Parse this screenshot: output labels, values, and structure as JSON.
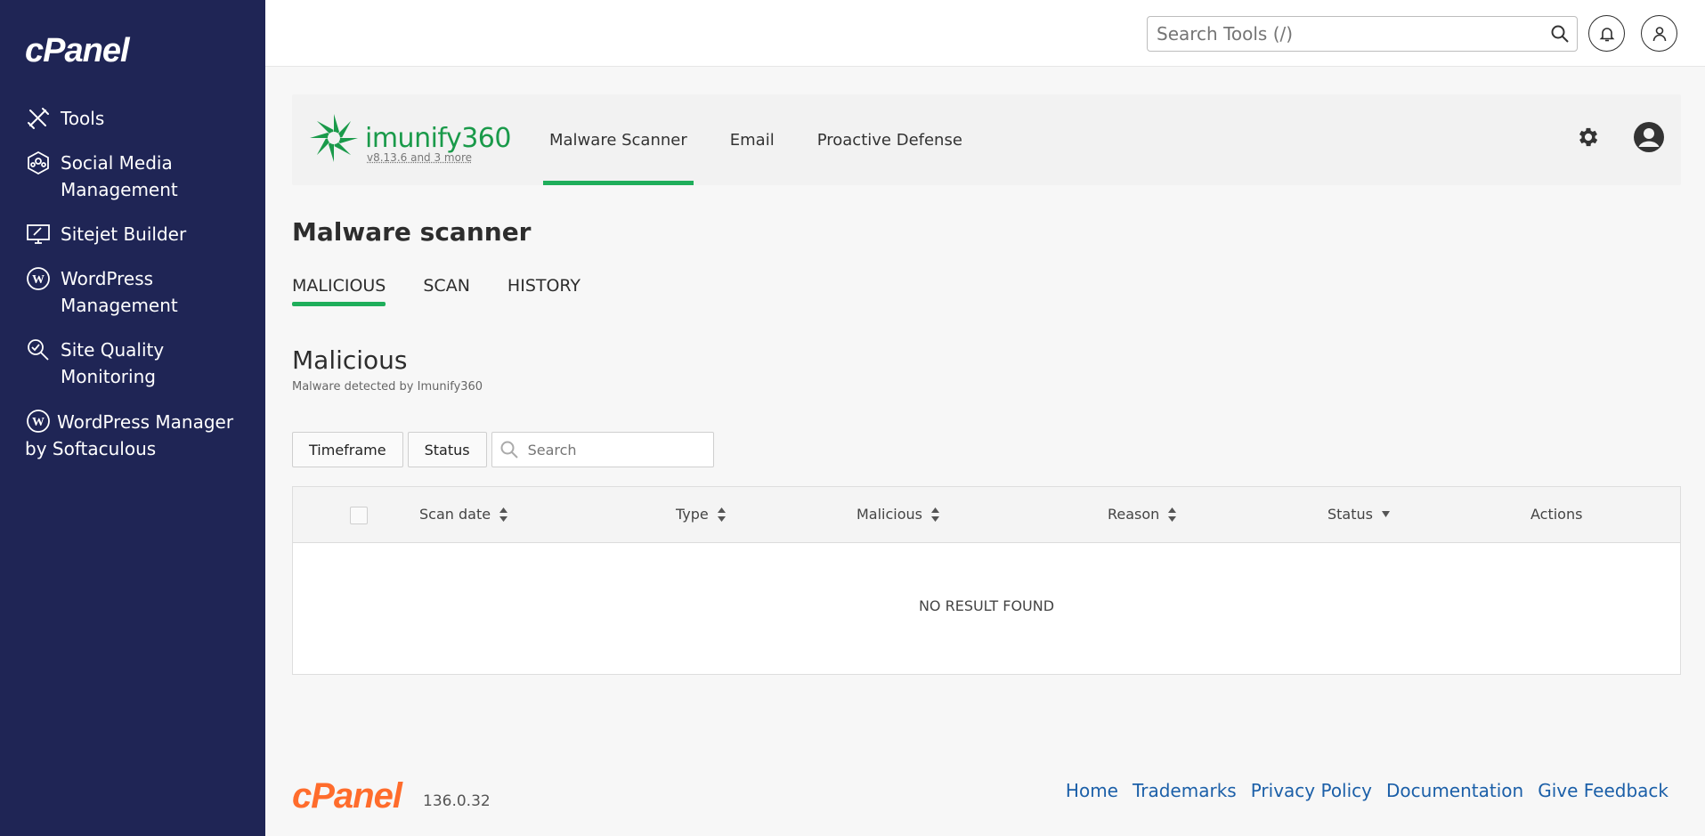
{
  "sidebar": {
    "logo": "cPanel",
    "items": [
      {
        "label": "Tools",
        "icon": "tools-icon"
      },
      {
        "label": "Social Media Management",
        "icon": "social-media-icon"
      },
      {
        "label": "Sitejet Builder",
        "icon": "sitejet-icon"
      },
      {
        "label": "WordPress Management",
        "icon": "wordpress-icon"
      },
      {
        "label": "Site Quality Monitoring",
        "icon": "site-quality-icon"
      },
      {
        "label": "WordPress Manager by Softaculous",
        "icon": "wordpress-icon"
      }
    ]
  },
  "header": {
    "search_placeholder": "Search Tools (/)"
  },
  "imunify": {
    "name": "imunify360",
    "version": "v8.13.6 and 3 more",
    "tabs": [
      "Malware Scanner",
      "Email",
      "Proactive Defense"
    ],
    "active_tab": "Malware Scanner"
  },
  "page": {
    "title": "Malware scanner",
    "sub_tabs": [
      "MALICIOUS",
      "SCAN",
      "HISTORY"
    ],
    "active_sub_tab": "MALICIOUS",
    "section_title": "Malicious",
    "section_subtitle": "Malware detected by Imunify360",
    "filters": {
      "timeframe_label": "Timeframe",
      "status_label": "Status",
      "search_placeholder": "Search"
    },
    "table": {
      "columns": [
        "Scan date",
        "Type",
        "Malicious",
        "Reason",
        "Status",
        "Actions"
      ],
      "empty_text": "NO RESULT FOUND"
    }
  },
  "footer": {
    "logo": "cPanel",
    "version": "136.0.32",
    "links": [
      "Home",
      "Trademarks",
      "Privacy Policy",
      "Documentation",
      "Give Feedback"
    ]
  },
  "colors": {
    "sidebar_bg": "#1f2555",
    "accent_green": "#1fae5b",
    "imunify_green": "#1a9a4a",
    "footer_logo": "#ff6c2c",
    "link_blue": "#1b5fa8"
  }
}
